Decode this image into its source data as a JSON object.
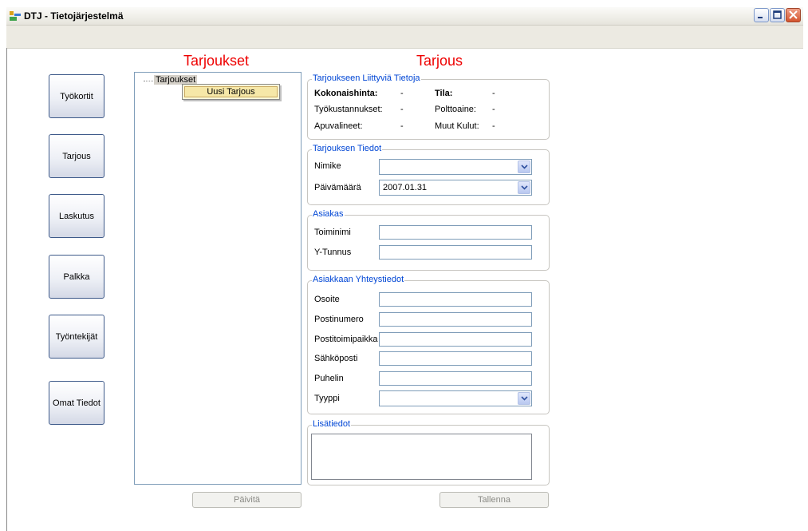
{
  "window": {
    "title": "DTJ - Tietojärjestelmä"
  },
  "nav": {
    "tyokortit": "Työkortit",
    "tarjous": "Tarjous",
    "laskutus": "Laskutus",
    "palkka": "Palkka",
    "tyontekijat": "Työntekijät",
    "omat_tiedot": "Omat Tiedot"
  },
  "left": {
    "heading": "Tarjoukset",
    "tree_root": "Tarjoukset",
    "context_menu_item": "Uusi Tarjous",
    "refresh_button": "Päivitä"
  },
  "right": {
    "heading": "Tarjous",
    "save_button": "Tallenna",
    "related": {
      "title": "Tarjoukseen Liittyviä Tietoja",
      "total_label": "Kokonaishinta:",
      "total_value": "-",
      "status_label": "Tila:",
      "status_value": "-",
      "labor_label": "Työkustannukset:",
      "labor_value": "-",
      "fuel_label": "Polttoaine:",
      "fuel_value": "-",
      "tools_label": "Apuvalineet:",
      "tools_value": "-",
      "other_label": "Muut Kulut:",
      "other_value": "-"
    },
    "offer": {
      "title": "Tarjouksen Tiedot",
      "name_label": "Nimike",
      "name_value": "",
      "date_label": "Päivämäärä",
      "date_value": "2007.01.31"
    },
    "customer": {
      "title": "Asiakas",
      "company_label": "Toiminimi",
      "business_id_label": "Y-Tunnus"
    },
    "contact": {
      "title": "Asiakkaan Yhteystiedot",
      "address_label": "Osoite",
      "postal_code_label": "Postinumero",
      "city_label": "Postitoimipaikka",
      "email_label": "Sähköposti",
      "phone_label": "Puhelin",
      "type_label": "Tyyppi",
      "type_value": ""
    },
    "notes": {
      "title": "Lisätiedot"
    }
  },
  "colors": {
    "heading": "#ee0000",
    "group_title": "#0046d5",
    "border": "#7f9db9"
  }
}
